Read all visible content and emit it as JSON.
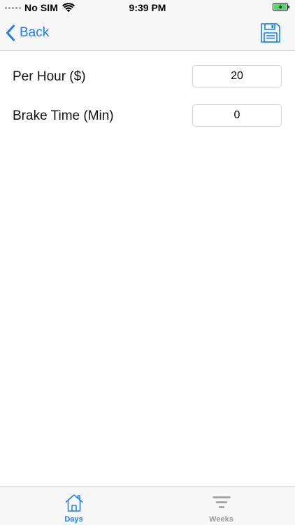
{
  "status_bar": {
    "carrier": "No SIM",
    "time": "9:39 PM",
    "icons": [
      "signal-dots-icon",
      "wifi-icon",
      "battery-charging-icon"
    ]
  },
  "nav": {
    "back_label": "Back",
    "save_icon": "floppy-disk-icon"
  },
  "form": {
    "per_hour": {
      "label": "Per Hour ($)",
      "value": "20"
    },
    "brake_time": {
      "label": "Brake Time (Min)",
      "value": "0"
    }
  },
  "tab_bar": {
    "tabs": [
      {
        "label": "Days",
        "icon": "house-icon",
        "selected": true
      },
      {
        "label": "Weeks",
        "icon": "filter-icon",
        "selected": false
      }
    ]
  },
  "colors": {
    "accent": "#1b7ef3",
    "inactive": "#9a9a9a",
    "battery_green": "#4cd964",
    "bar_background": "#f7f7f7"
  }
}
